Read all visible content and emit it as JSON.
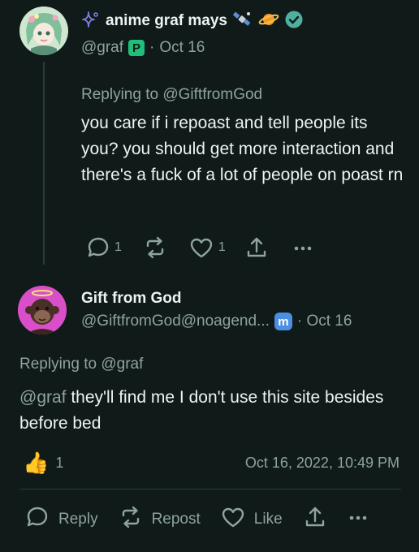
{
  "post1": {
    "author_name": "anime graf mays",
    "handle": "@graf",
    "platform_badge": "P",
    "date": "Oct 16",
    "replying_to_prefix": "Replying to ",
    "replying_to": "@GiftfromGod",
    "body": "you care if i repoast and tell people its you? you should get more interaction and there's a fuck of a lot of people on poast rn",
    "reply_count": "1",
    "like_count": "1",
    "icons": [
      "sparkle-icon",
      "satellite-icon",
      "planet-icon",
      "verified-icon",
      "reply-icon",
      "repost-icon",
      "like-icon",
      "share-icon",
      "more-icon"
    ]
  },
  "post2": {
    "author_name": "Gift from God",
    "handle": "@GiftfromGod@noagend...",
    "platform_badge": "m",
    "date": "· Oct 16",
    "replying_to_prefix": "Replying to ",
    "replying_to": "@graf",
    "mention": "@graf",
    "body_rest": " they'll find me I don't use this site besides before bed",
    "reaction_emoji": "👍",
    "reaction_count": "1",
    "timestamp": "Oct 16, 2022, 10:49 PM",
    "actions": {
      "reply": "Reply",
      "repost": "Repost",
      "like": "Like"
    }
  },
  "colors": {
    "background": "#0f1a19",
    "muted": "#8fa3a0",
    "verified": "#4fb0a0",
    "poast_badge": "#1fbf7a",
    "mastodon_badge": "#4c8fe0"
  }
}
